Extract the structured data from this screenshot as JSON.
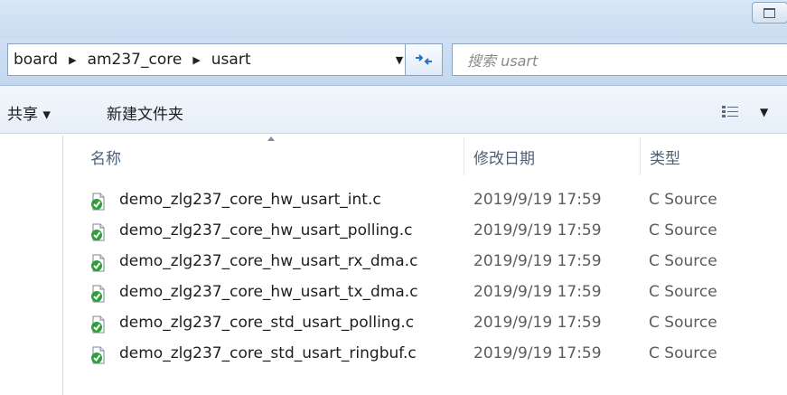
{
  "navigation": {
    "breadcrumbs": [
      "board",
      "am237_core",
      "usart"
    ],
    "search_placeholder": "搜索 usart"
  },
  "toolbar": {
    "share_label": "共享 ▾",
    "new_folder_label": "新建文件夹"
  },
  "columns": {
    "name": "名称",
    "date_modified": "修改日期",
    "type": "类型"
  },
  "files": [
    {
      "name": "demo_zlg237_core_hw_usart_int.c",
      "date": "2019/9/19 17:59",
      "type": "C Source"
    },
    {
      "name": "demo_zlg237_core_hw_usart_polling.c",
      "date": "2019/9/19 17:59",
      "type": "C Source"
    },
    {
      "name": "demo_zlg237_core_hw_usart_rx_dma.c",
      "date": "2019/9/19 17:59",
      "type": "C Source"
    },
    {
      "name": "demo_zlg237_core_hw_usart_tx_dma.c",
      "date": "2019/9/19 17:59",
      "type": "C Source"
    },
    {
      "name": "demo_zlg237_core_std_usart_polling.c",
      "date": "2019/9/19 17:59",
      "type": "C Source"
    },
    {
      "name": "demo_zlg237_core_std_usart_ringbuf.c",
      "date": "2019/9/19 17:59",
      "type": "C Source"
    }
  ],
  "icons": {
    "file": "c-source-file-icon",
    "refresh": "refresh-icon",
    "views": "view-options-icon"
  },
  "colors": {
    "file_icon_badge": "#2e9e3a",
    "header_text": "#4c607a",
    "chrome": "#c9dcf1"
  }
}
